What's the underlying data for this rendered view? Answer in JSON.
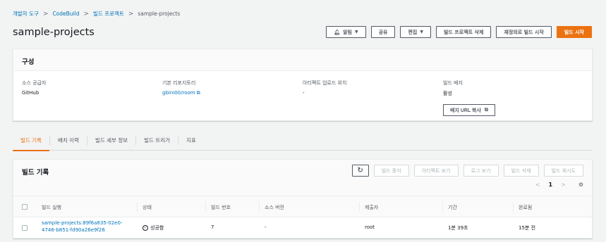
{
  "breadcrumb": {
    "items": [
      "개발자 도구",
      "CodeBuild",
      "빌드 프로젝트"
    ],
    "current": "sample-projects",
    "separator": ">"
  },
  "page": {
    "title": "sample-projects"
  },
  "header_actions": {
    "notify": "알림",
    "share": "공유",
    "edit": "편집",
    "delete_project": "빌드 프로젝트 삭제",
    "retry_build": "재정의로 빌드 시작",
    "start_build": "빌드 시작"
  },
  "config": {
    "title": "구성",
    "source_provider": {
      "label": "소스 공급자",
      "value": "GitHub"
    },
    "primary_repo": {
      "label": "기본 리포지토리",
      "value": "gbini00/room"
    },
    "artifact_upload": {
      "label": "아티팩트 업로드 위치",
      "value": "-"
    },
    "build_badge": {
      "label": "빌드 배지",
      "value": "활성",
      "copy_label": "배지 URL 복사"
    }
  },
  "tabs": [
    "빌드 기록",
    "배치 이력",
    "빌드 세부 정보",
    "빌드 트리거",
    "지표"
  ],
  "history": {
    "title": "빌드 기록",
    "actions": [
      "빌드 중지",
      "아티팩트 보기",
      "로그 보기",
      "빌드 삭제",
      "빌드 재시도"
    ],
    "pager": {
      "page": "1",
      "prev": "<",
      "next": ">"
    },
    "columns": [
      "빌드 실행",
      "상태",
      "빌드 번호",
      "소스 버전",
      "제출자",
      "기간",
      "완료됨"
    ],
    "rows": [
      {
        "run": "sample-projects:89f6a835-02e0-4746-b851-fd90a26e9f26",
        "status": "성공함",
        "number": "7",
        "source_version": "-",
        "submitter": "root",
        "duration": "1분 39초",
        "completed": "15분 전"
      }
    ]
  },
  "colors": {
    "accent": "#ec7211",
    "link": "#0073bb",
    "text": "#16191f",
    "background": "#f2f3f3"
  }
}
